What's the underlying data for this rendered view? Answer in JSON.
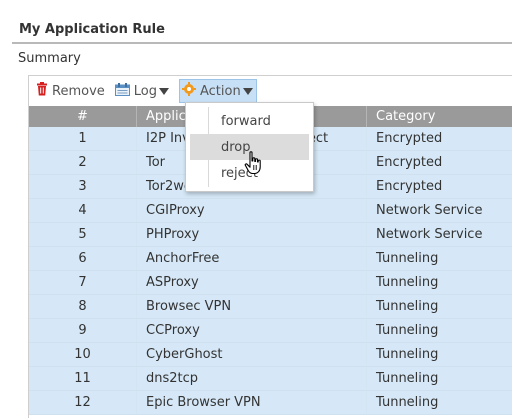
{
  "section": {
    "title": "My Application Rule",
    "summary_label": "Summary"
  },
  "toolbar": {
    "remove_label": "Remove",
    "log_label": "Log",
    "action_label": "Action"
  },
  "menu": {
    "items": [
      "forward",
      "drop",
      "reject"
    ],
    "hovered": "drop"
  },
  "table": {
    "columns": [
      "#",
      "Application",
      "Category"
    ],
    "rows": [
      {
        "num": "1",
        "app": "I2P Invisible Internet Project",
        "cat": "Encrypted"
      },
      {
        "num": "2",
        "app": "Tor",
        "cat": "Encrypted"
      },
      {
        "num": "3",
        "app": "Tor2web",
        "cat": "Encrypted"
      },
      {
        "num": "4",
        "app": "CGIProxy",
        "cat": "Network Service"
      },
      {
        "num": "5",
        "app": "PHProxy",
        "cat": "Network Service"
      },
      {
        "num": "6",
        "app": "AnchorFree",
        "cat": "Tunneling"
      },
      {
        "num": "7",
        "app": "ASProxy",
        "cat": "Tunneling"
      },
      {
        "num": "8",
        "app": "Browsec VPN",
        "cat": "Tunneling"
      },
      {
        "num": "9",
        "app": "CCProxy",
        "cat": "Tunneling"
      },
      {
        "num": "10",
        "app": "CyberGhost",
        "cat": "Tunneling"
      },
      {
        "num": "11",
        "app": "dns2tcp",
        "cat": "Tunneling"
      },
      {
        "num": "12",
        "app": "Epic Browser VPN",
        "cat": "Tunneling"
      }
    ]
  },
  "colors": {
    "header_bg": "#9a9a9a",
    "row_bg": "#d6e8f7",
    "action_active_bg": "#c8e0f6",
    "remove_icon": "#d62020"
  },
  "icons": {
    "remove": "trash-icon",
    "log": "log-icon",
    "action": "gear-icon",
    "cursor": "hand-pointer-icon"
  }
}
